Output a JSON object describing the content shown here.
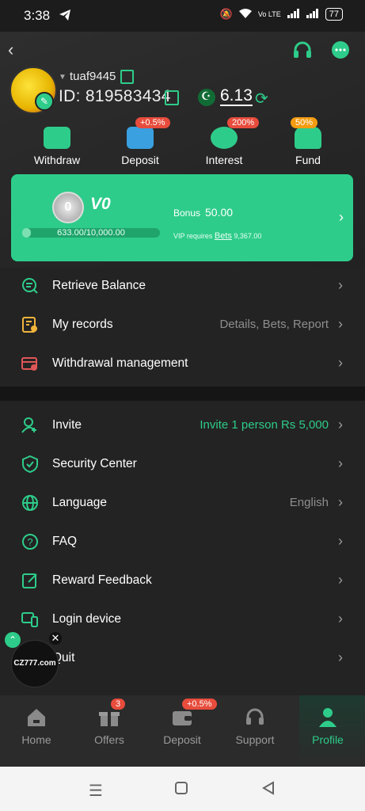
{
  "status": {
    "time": "3:38",
    "network": "Vo LTE",
    "battery": "77"
  },
  "user": {
    "username": "tuaf9445",
    "id_label": "ID:",
    "id": "819583434",
    "balance": "6.13"
  },
  "quick_actions": [
    {
      "label": "Withdraw",
      "tag": ""
    },
    {
      "label": "Deposit",
      "tag": "+0.5%"
    },
    {
      "label": "Interest",
      "tag": "200%"
    },
    {
      "label": "Fund",
      "tag": "50%"
    }
  ],
  "vip": {
    "medal": "0",
    "level": "V0",
    "progress_text": "633.00/10,000.00",
    "progress_fraction": 0.0633,
    "bonus_label": "Bonus",
    "bonus_value": "50.00",
    "req_prefix": "VIP requires",
    "req_link": "Bets",
    "req_value": "9,367.00"
  },
  "menu1": [
    {
      "label": "Retrieve Balance",
      "value": ""
    },
    {
      "label": "My records",
      "value": "Details, Bets, Report"
    },
    {
      "label": "Withdrawal management",
      "value": ""
    }
  ],
  "menu2": [
    {
      "label": "Invite",
      "value": "Invite 1 person Rs 5,000"
    },
    {
      "label": "Security Center",
      "value": ""
    },
    {
      "label": "Language",
      "value": "English"
    },
    {
      "label": "FAQ",
      "value": ""
    },
    {
      "label": "Reward Feedback",
      "value": ""
    },
    {
      "label": "Login device",
      "value": ""
    },
    {
      "label": "Quit",
      "value": ""
    }
  ],
  "float_logo": "CZ777.com",
  "tabs": [
    {
      "label": "Home",
      "badge": ""
    },
    {
      "label": "Offers",
      "badge": "3"
    },
    {
      "label": "Deposit",
      "badge": "+0.5%"
    },
    {
      "label": "Support",
      "badge": ""
    },
    {
      "label": "Profile",
      "badge": ""
    }
  ],
  "colors": {
    "accent": "#2ecc8a",
    "background": "#232323",
    "tag_red": "#e74c3c",
    "tag_orange": "#f39c12"
  }
}
